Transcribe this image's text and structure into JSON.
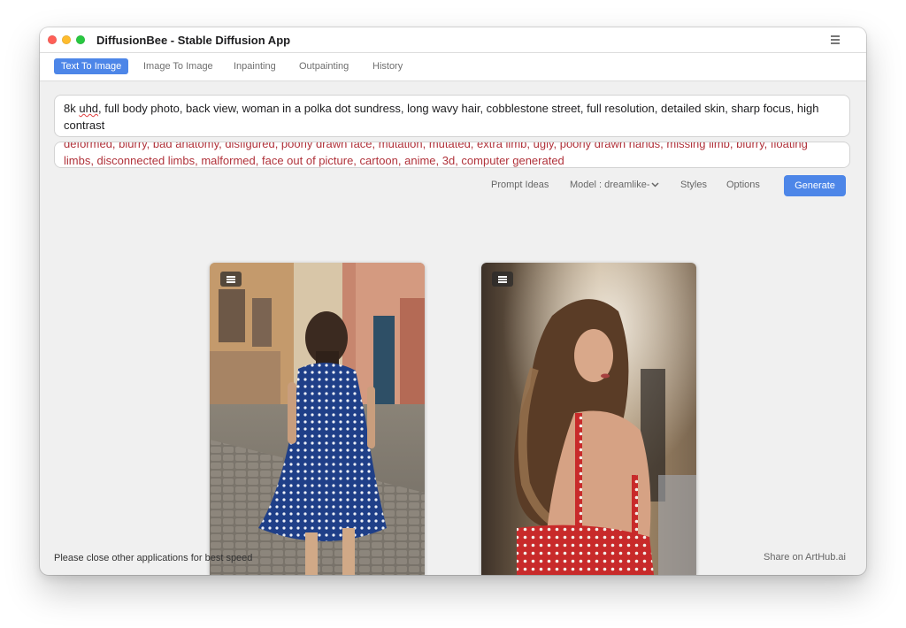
{
  "window": {
    "title": "DiffusionBee - Stable Diffusion App"
  },
  "tabs": [
    {
      "label": "Text To Image",
      "active": true
    },
    {
      "label": "Image To Image",
      "active": false
    },
    {
      "label": "Inpainting",
      "active": false
    },
    {
      "label": "Outpainting",
      "active": false
    },
    {
      "label": "History",
      "active": false
    }
  ],
  "prompt": {
    "prefix": "8k ",
    "misspelled": "uhd",
    "rest": ", full body photo, back view, woman in a polka dot sundress, long wavy hair, cobblestone street, full resolution, detailed skin, sharp focus, high contrast"
  },
  "negative_prompt": {
    "value": "deformed, blurry, bad anatomy, disfigured, poorly drawn face, mutation, mutated, extra limb, ugly, poorly drawn hands, missing limb, blurry, floating limbs, disconnected limbs, malformed, face out of picture, cartoon, anime, 3d, computer generated"
  },
  "toolbar": {
    "prompt_ideas": "Prompt Ideas",
    "model": "Model : dreamlike-",
    "styles": "Styles",
    "options": "Options",
    "generate": "Generate"
  },
  "images": [
    {
      "name": "generated-image-1",
      "description_icon": "image-options-menu-icon"
    },
    {
      "name": "generated-image-2",
      "description_icon": "image-options-menu-icon"
    }
  ],
  "footer": {
    "tip": "Please close other applications for best speed",
    "share": "Share on ArtHub.ai"
  },
  "colors": {
    "accent": "#4d86e8",
    "negative_text": "#b0323a",
    "window_bg": "#f0f0f0"
  }
}
